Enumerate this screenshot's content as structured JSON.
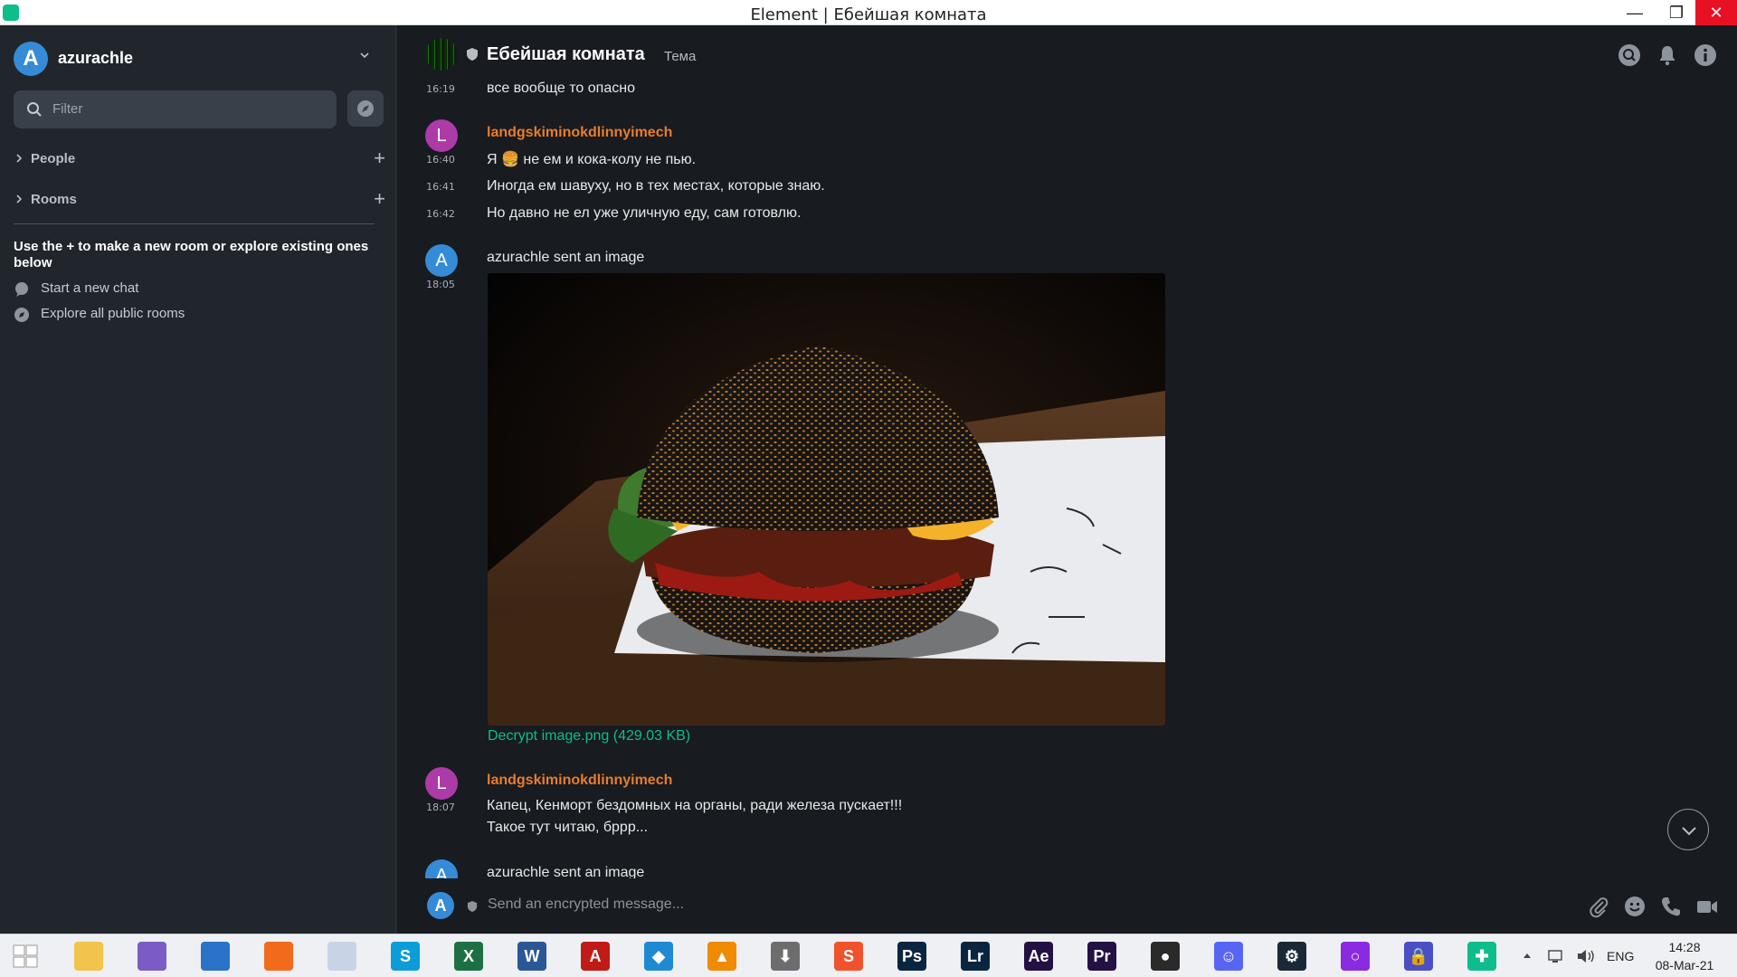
{
  "window": {
    "title": "Element | Ебейшая комната",
    "minimize": "—",
    "maximize": "❐",
    "close": "✕"
  },
  "sidebar": {
    "user": {
      "avatar_letter": "A",
      "name": "azurachle"
    },
    "filter_placeholder": "Filter",
    "sections": [
      {
        "label": "People"
      },
      {
        "label": "Rooms"
      }
    ],
    "hint": "Use the + to make a new room or explore existing ones below",
    "links": [
      {
        "label": "Start a new chat",
        "icon": "chat-bubble-icon"
      },
      {
        "label": "Explore all public rooms",
        "icon": "compass-icon"
      }
    ]
  },
  "room": {
    "name": "Ебейшая комната",
    "topic": "Тема"
  },
  "timeline": {
    "m1": {
      "time": "16:19",
      "text": "все вообще то опасно"
    },
    "g2": {
      "avatar": "L",
      "sender": "landgskiminokdlinnyimech",
      "lines": [
        {
          "time": "16:40",
          "text": "Я 🍔 не ем и кока-колу не пью."
        },
        {
          "time": "16:41",
          "text": "Иногда ем шавуху, но в тех местах, которые знаю."
        },
        {
          "time": "16:42",
          "text": "Но давно не ел уже уличную еду, сам готовлю."
        }
      ]
    },
    "g3": {
      "avatar": "A",
      "sender": "azurachle sent an image",
      "time": "18:05",
      "image_alt": "black sesame-bun burger",
      "file_link": "Decrypt image.png (429.03 KB)"
    },
    "g4": {
      "avatar": "L",
      "sender": "landgskiminokdlinnyimech",
      "time": "18:07",
      "lines": [
        "Капец, Кенморт бездомных на органы, ради железа пускает!!!",
        "Такое тут читаю, брpp..."
      ]
    },
    "g5": {
      "avatar": "A",
      "sender": "azurachle sent an image"
    }
  },
  "composer": {
    "avatar_letter": "A",
    "placeholder": "Send an encrypted message..."
  },
  "taskbar": {
    "apps": [
      {
        "name": "start-button",
        "color": "#ffffff",
        "label": ""
      },
      {
        "name": "file-explorer",
        "color": "#f3c44c",
        "label": ""
      },
      {
        "name": "torrent-client",
        "color": "#7b5cc7",
        "label": ""
      },
      {
        "name": "browser-globe",
        "color": "#2a73c9",
        "label": ""
      },
      {
        "name": "firefox",
        "color": "#f26a1b",
        "label": ""
      },
      {
        "name": "moon-app",
        "color": "#c8d4e6",
        "label": ""
      },
      {
        "name": "skype",
        "color": "#0c9dd9",
        "label": "S"
      },
      {
        "name": "excel",
        "color": "#1d7044",
        "label": "X"
      },
      {
        "name": "word",
        "color": "#2b5797",
        "label": "W"
      },
      {
        "name": "acrobat",
        "color": "#c11b17",
        "label": "A"
      },
      {
        "name": "vscode",
        "color": "#1f8ad2",
        "label": "◆"
      },
      {
        "name": "vlc",
        "color": "#f08a00",
        "label": "▲"
      },
      {
        "name": "downloader",
        "color": "#6d6d6d",
        "label": "⬇"
      },
      {
        "name": "smartgit",
        "color": "#f0522b",
        "label": "S"
      },
      {
        "name": "photoshop",
        "color": "#0a2540",
        "label": "Ps"
      },
      {
        "name": "lightroom",
        "color": "#0a2540",
        "label": "Lr"
      },
      {
        "name": "after-effects",
        "color": "#231044",
        "label": "Ae"
      },
      {
        "name": "premiere",
        "color": "#231044",
        "label": "Pr"
      },
      {
        "name": "obs",
        "color": "#2a2a2a",
        "label": "●"
      },
      {
        "name": "discord",
        "color": "#5865f2",
        "label": "☺"
      },
      {
        "name": "steam",
        "color": "#1b2838",
        "label": "⚙"
      },
      {
        "name": "cortana-ring",
        "color": "#8a2be2",
        "label": "○"
      },
      {
        "name": "vpn-lock",
        "color": "#4a4fc4",
        "label": "🔒"
      },
      {
        "name": "element",
        "color": "#0dbd8b",
        "label": "✚"
      }
    ],
    "tray": {
      "lang": "ENG",
      "time": "14:28",
      "date": "08-Mar-21"
    }
  }
}
